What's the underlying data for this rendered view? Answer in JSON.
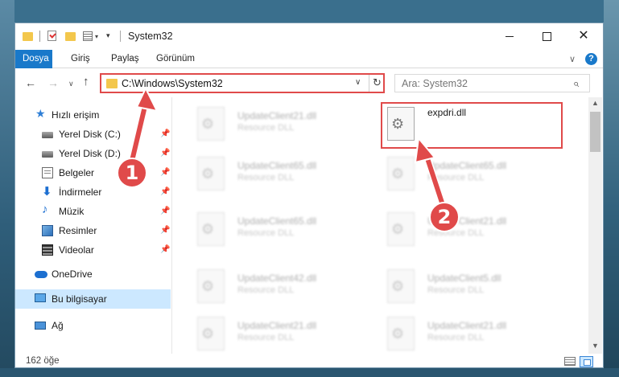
{
  "window": {
    "title": "System32",
    "controls": {
      "minimize": "minimize-icon",
      "maximize": "maximize-icon",
      "close": "✕"
    }
  },
  "quick_access_toolbar": {
    "icons": [
      "folder-icon",
      "properties-icon",
      "new-folder-icon",
      "view-icon",
      "customize-dropdown-icon"
    ]
  },
  "ribbon": {
    "tabs": [
      {
        "label": "Dosya",
        "active": true
      },
      {
        "label": "Giriş",
        "active": false
      },
      {
        "label": "Paylaş",
        "active": false
      },
      {
        "label": "Görünüm",
        "active": false
      }
    ],
    "help": "?",
    "accent_color": "#1979ca"
  },
  "navigation": {
    "back": "←",
    "forward": "→",
    "recent": "∨",
    "up": "↑",
    "address": "C:\\Windows\\System32",
    "address_chevron": "∨",
    "refresh": "↻",
    "search_placeholder": "Ara: System32",
    "search_icon": "⌕"
  },
  "sidebar": {
    "items": [
      {
        "label": "Hızlı erişim",
        "icon": "star-icon",
        "pinned": false
      },
      {
        "label": "Yerel Disk (C:)",
        "icon": "drive-icon",
        "pinned": true
      },
      {
        "label": "Yerel Disk (D:)",
        "icon": "drive-icon",
        "pinned": true
      },
      {
        "label": "Belgeler",
        "icon": "documents-icon",
        "pinned": true
      },
      {
        "label": "İndirmeler",
        "icon": "download-icon",
        "pinned": true
      },
      {
        "label": "Müzik",
        "icon": "music-icon",
        "pinned": true
      },
      {
        "label": "Resimler",
        "icon": "pictures-icon",
        "pinned": true
      },
      {
        "label": "Videolar",
        "icon": "videos-icon",
        "pinned": true
      },
      {
        "label": "OneDrive",
        "icon": "cloud-icon",
        "pinned": false
      },
      {
        "label": "Bu bilgisayar",
        "icon": "computer-icon",
        "pinned": false,
        "selected": true
      },
      {
        "label": "Ağ",
        "icon": "network-icon",
        "pinned": false
      }
    ],
    "pin_glyph": "📌"
  },
  "files": {
    "left_column": [
      {
        "name": "UpdateClient21.dll",
        "type": "Resource DLL"
      },
      {
        "name": "UpdateClient65.dll",
        "type": "Resource DLL"
      },
      {
        "name": "UpdateClient65.dll",
        "type": "Resource DLL"
      },
      {
        "name": "UpdateClient42.dll",
        "type": "Resource DLL"
      },
      {
        "name": "UpdateClient21.dll",
        "type": "Resource DLL"
      }
    ],
    "right_column": [
      {
        "name": "expdri.dll",
        "type": "",
        "highlighted": true
      },
      {
        "name": "UpdateClient65.dll",
        "type": "Resource DLL"
      },
      {
        "name": "UpdateClient21.dll",
        "type": "Resource DLL"
      },
      {
        "name": "UpdateClient5.dll",
        "type": "Resource DLL"
      },
      {
        "name": "UpdateClient21.dll",
        "type": "Resource DLL"
      }
    ]
  },
  "status_bar": {
    "item_count": "162 öğe",
    "view_buttons": [
      "details-view-icon",
      "large-icons-view-icon"
    ]
  },
  "annotations": {
    "step1": "1",
    "step2": "2",
    "color": "#e04a4a"
  }
}
